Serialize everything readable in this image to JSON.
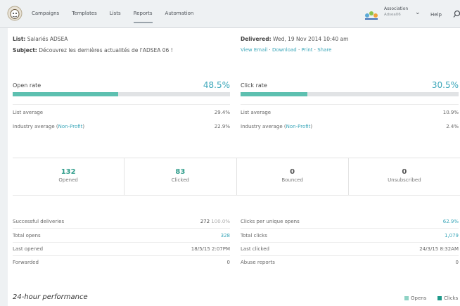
{
  "nav": {
    "items": [
      "Campaigns",
      "Templates",
      "Lists",
      "Reports",
      "Automation"
    ],
    "active_index": 3
  },
  "account": {
    "name": "Association",
    "sub": "Adsea06"
  },
  "help_label": "Help",
  "summary": {
    "list_label": "List:",
    "list_value": "Salariés ADSEA",
    "subject_label": "Subject:",
    "subject_value": "Découvrez les dernières actualités de l'ADSEA 06 !",
    "delivered_label": "Delivered:",
    "delivered_value": "Wed, 19 Nov 2014 10:40 am",
    "links": {
      "view_email": "View Email",
      "download": "Download",
      "print": "Print",
      "share": "Share",
      "sep": " · "
    }
  },
  "open_rate": {
    "title": "Open rate",
    "value": "48.5%",
    "fraction": 0.485,
    "list_avg_label": "List average",
    "list_avg": "29.4%",
    "industry_label": "Industry average",
    "industry_paren_open": "(",
    "industry_type": "Non-Profit",
    "industry_paren_close": ")",
    "industry_avg": "22.9%"
  },
  "click_rate": {
    "title": "Click rate",
    "value": "30.5%",
    "fraction": 0.305,
    "list_avg_label": "List average",
    "list_avg": "10.9%",
    "industry_label": "Industry average",
    "industry_paren_open": "(",
    "industry_type": "Non-Profit",
    "industry_paren_close": ")",
    "industry_avg": "2.4%"
  },
  "stats": [
    {
      "value": "132",
      "label": "Opened",
      "color": "#2e9c8a"
    },
    {
      "value": "83",
      "label": "Clicked",
      "color": "#2e9c8a"
    },
    {
      "value": "0",
      "label": "Bounced",
      "color": "#555555"
    },
    {
      "value": "0",
      "label": "Unsubscribed",
      "color": "#555555"
    }
  ],
  "left_details": [
    {
      "label": "Successful deliveries",
      "value": "272",
      "extra": "100.0%"
    },
    {
      "label": "Total opens",
      "value": "328"
    },
    {
      "label": "Last opened",
      "value": "18/5/15 2:07PM"
    },
    {
      "label": "Forwarded",
      "value": "0"
    }
  ],
  "right_details": [
    {
      "label": "Clicks per unique opens",
      "value": "62.9%"
    },
    {
      "label": "Total clicks",
      "value": "1,079"
    },
    {
      "label": "Last clicked",
      "value": "24/3/15 8:32AM"
    },
    {
      "label": "Abuse reports",
      "value": "0"
    }
  ],
  "performance": {
    "title": "24-hour performance",
    "legend": [
      {
        "label": "Opens",
        "color": "#8fd3c5"
      },
      {
        "label": "Clicks",
        "color": "#1f9a8a"
      }
    ]
  },
  "colors": {
    "accent": "#3aa6b9",
    "bar_fill": "#5dc0b0",
    "bar_bg": "#e1e3e5"
  }
}
